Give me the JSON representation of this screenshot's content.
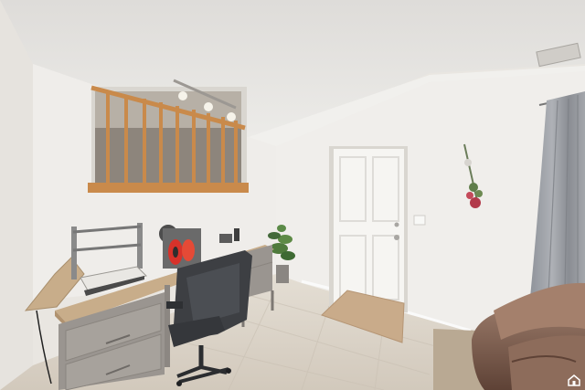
{
  "scene": {
    "description_kind": "photo",
    "palette": {
      "ceiling": "#e4e2df",
      "wall": "#eeece9",
      "floor_tile": "#ddd6cc",
      "desk_wood": "#c8ad8a",
      "desk_frame": "#9a9590",
      "railing_wood": "#c98a4b",
      "curtain": "#9da0a6",
      "leather": "#8a6a5a",
      "door": "#f5f4f1",
      "mat": "#c9ab8a"
    }
  }
}
